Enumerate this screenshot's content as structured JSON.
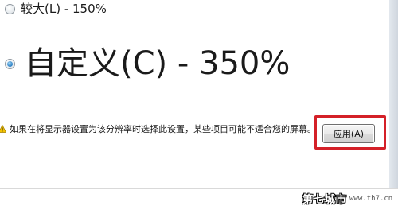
{
  "options": {
    "large": {
      "label": "较大(L) - 150%",
      "selected": false
    },
    "custom": {
      "label": "自定义(C) - 350%",
      "selected": true
    }
  },
  "warning": {
    "icon": "warning-icon",
    "text": "如果在将显示器设置为该分辨率时选择此设置，某些项目可能不适合您的屏幕。"
  },
  "apply_button": {
    "label": "应用(A)",
    "highlight_color": "#d42028"
  },
  "watermark": {
    "text": "第七城市",
    "url": "www.th7.cn"
  }
}
